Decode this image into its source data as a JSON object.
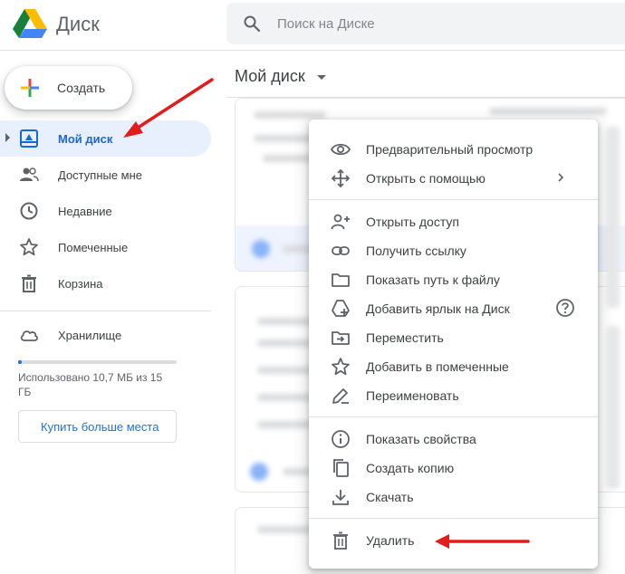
{
  "app": {
    "title": "Диск"
  },
  "search": {
    "placeholder": "Поиск на Диске"
  },
  "sidebar": {
    "create_label": "Создать",
    "items": [
      {
        "label": "Мой диск",
        "icon": "my-drive-icon",
        "active": true
      },
      {
        "label": "Доступные мне",
        "icon": "shared-people-icon"
      },
      {
        "label": "Недавние",
        "icon": "clock-icon"
      },
      {
        "label": "Помеченные",
        "icon": "star-icon"
      },
      {
        "label": "Корзина",
        "icon": "trash-icon"
      },
      {
        "label": "Хранилище",
        "icon": "cloud-icon"
      }
    ],
    "storage_text": "Использовано 10,7 МБ из 15 ГБ",
    "storage_used_fraction": 0.0007,
    "buy_label": "Купить больше места"
  },
  "main": {
    "title": "Мой диск"
  },
  "context_menu": {
    "items": [
      {
        "label": "Предварительный просмотр",
        "icon": "eye-icon"
      },
      {
        "label": "Открыть с помощью",
        "icon": "move-arrows-icon",
        "submenu": true
      },
      {
        "label": "Открыть доступ",
        "icon": "person-add-icon"
      },
      {
        "label": "Получить ссылку",
        "icon": "link-icon"
      },
      {
        "label": "Показать путь к файлу",
        "icon": "folder-icon"
      },
      {
        "label": "Добавить ярлык на Диск",
        "icon": "drive-shortcut-icon",
        "help": true
      },
      {
        "label": "Переместить",
        "icon": "move-to-folder-icon"
      },
      {
        "label": "Добавить в помеченные",
        "icon": "star-icon"
      },
      {
        "label": "Переименовать",
        "icon": "pencil-icon"
      },
      {
        "label": "Показать свойства",
        "icon": "info-icon"
      },
      {
        "label": "Создать копию",
        "icon": "copy-icon"
      },
      {
        "label": "Скачать",
        "icon": "download-icon"
      },
      {
        "label": "Удалить",
        "icon": "trash-icon"
      }
    ]
  },
  "colors": {
    "accent": "#1a73e8",
    "active_bg": "#e8f0fe",
    "annotation": "#e41b1b"
  }
}
